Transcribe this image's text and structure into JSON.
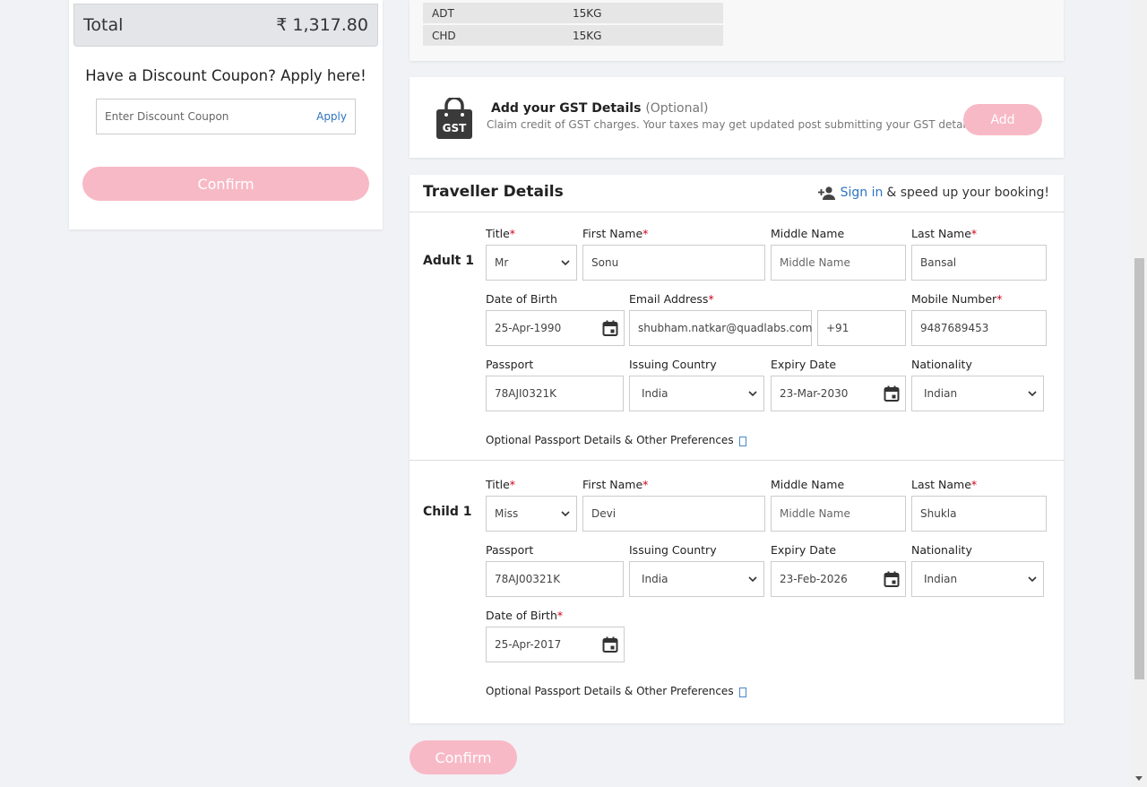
{
  "summary": {
    "total_label": "Total",
    "total_value": "₹ 1,317.80",
    "coupon_title": "Have a Discount Coupon? Apply here!",
    "coupon_placeholder": "Enter Discount Coupon",
    "coupon_apply": "Apply",
    "confirm_label": "Confirm"
  },
  "baggage": {
    "rows": [
      {
        "type": "ADT",
        "allowance": "15KG"
      },
      {
        "type": "CHD",
        "allowance": "15KG"
      }
    ]
  },
  "gst": {
    "icon": "gst-bag-icon",
    "icon_text": "GST",
    "title": "Add your GST Details",
    "optional": "(Optional)",
    "subtitle": "Claim credit of GST charges. Your taxes may get updated post submitting your GST details.",
    "add_label": "Add"
  },
  "traveller": {
    "title": "Traveller Details",
    "signin_link": "Sign in",
    "signin_rest": "& speed up your booking!",
    "optional_prefs": "Optional Passport Details & Other Preferences",
    "labels": {
      "title": "Title",
      "first_name": "First Name",
      "middle_name": "Middle Name",
      "last_name": "Last Name",
      "dob": "Date of Birth",
      "email": "Email Address",
      "mobile": "Mobile Number",
      "passport": "Passport",
      "issuing_country": "Issuing Country",
      "expiry": "Expiry Date",
      "nationality": "Nationality"
    },
    "adult": {
      "label": "Adult 1",
      "title": "Mr",
      "first_name": "Sonu",
      "middle_name_placeholder": "Middle Name",
      "last_name": "Bansal",
      "dob": "25-Apr-1990",
      "email": "shubham.natkar@quadlabs.com",
      "country_code": "+91",
      "mobile": "9487689453",
      "passport": "78AJI0321K",
      "issuing_country": "India",
      "expiry": "23-Mar-2030",
      "nationality": "Indian"
    },
    "child": {
      "label": "Child 1",
      "title": "Miss",
      "first_name": "Devi",
      "middle_name_placeholder": "Middle Name",
      "last_name": "Shukla",
      "passport": "78AJ00321K",
      "issuing_country": "India",
      "expiry": "23-Feb-2026",
      "nationality": "Indian",
      "dob": "25-Apr-2017"
    }
  },
  "footer": {
    "confirm_label": "Confirm"
  },
  "colors": {
    "accent_pink": "#f8b9c6",
    "link_blue": "#2f74c0",
    "required_red": "#d0021b"
  }
}
